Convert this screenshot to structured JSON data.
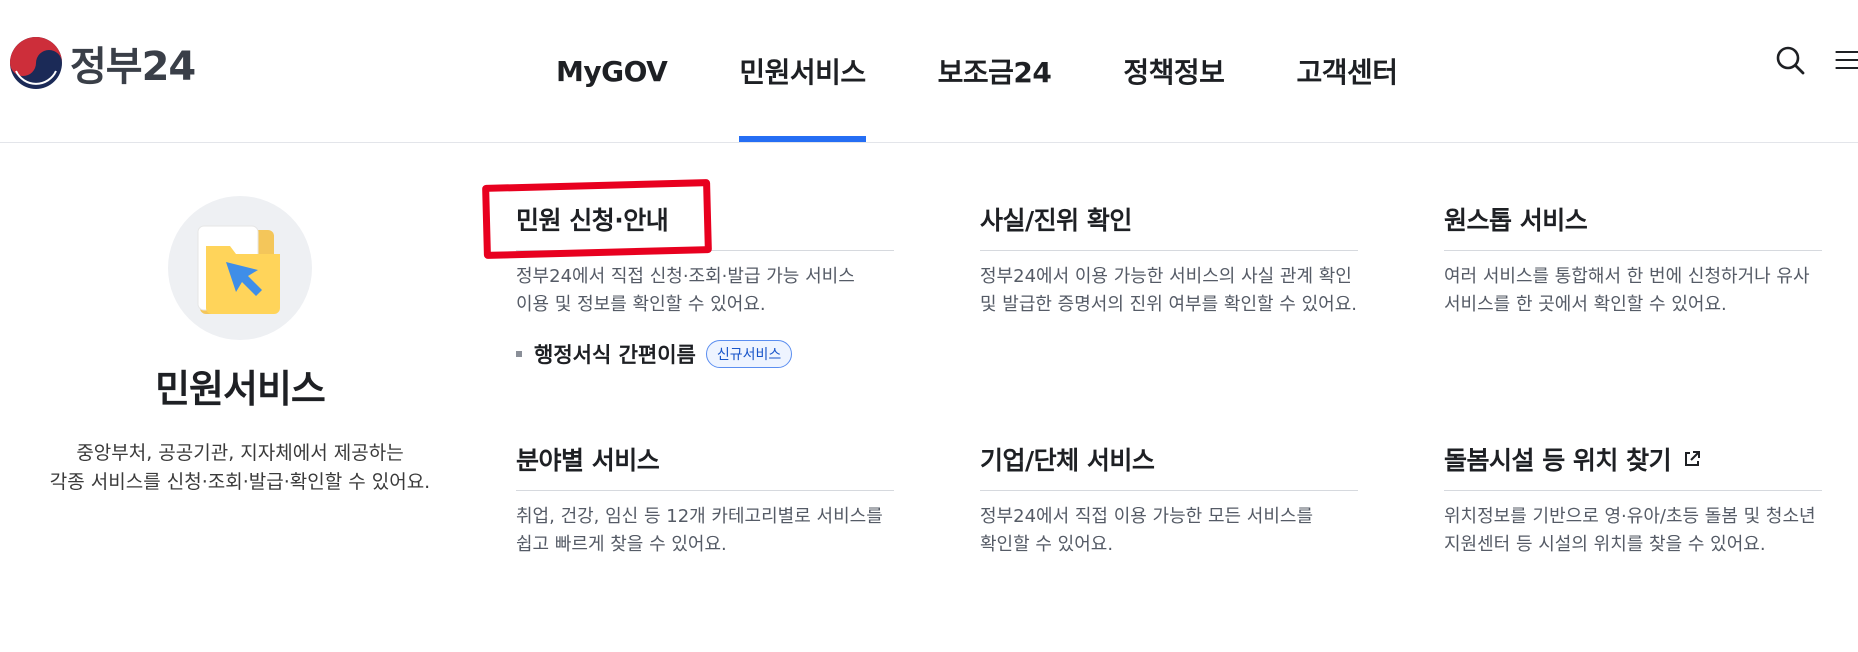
{
  "header": {
    "logo_text": "정부24",
    "nav": [
      {
        "label": "MyGOV",
        "active": false
      },
      {
        "label": "민원서비스",
        "active": true
      },
      {
        "label": "보조금24",
        "active": false
      },
      {
        "label": "정책정보",
        "active": false
      },
      {
        "label": "고객센터",
        "active": false
      }
    ],
    "utility_icons": [
      "search-icon",
      "menu-icon"
    ],
    "accent_color": "#256ef4"
  },
  "promo": {
    "icon": "folder-cursor-icon",
    "title": "민원서비스",
    "desc_line1": "중앙부처, 공공기관, 지자체에서 제공하는",
    "desc_line2": "각종 서비스를 신청·조회·발급·확인할 수 있어요."
  },
  "cards": [
    {
      "title": "민원 신청·안내",
      "desc_line1": "정부24에서 직접 신청·조회·발급 가능 서비스",
      "desc_line2": "이용 및 정보를 확인할 수 있어요.",
      "sub_link": "행정서식 간편이름",
      "badge": "신규서비스",
      "highlighted": true
    },
    {
      "title": "사실/진위 확인",
      "desc_line1": "정부24에서 이용 가능한 서비스의 사실 관계 확인",
      "desc_line2": "및 발급한 증명서의 진위 여부를 확인할 수 있어요."
    },
    {
      "title": "원스톱 서비스",
      "desc_line1": "여러 서비스를 통합해서 한 번에 신청하거나 유사",
      "desc_line2": "서비스를 한 곳에서 확인할 수 있어요."
    },
    {
      "title": "분야별 서비스",
      "desc_line1": "취업, 건강, 임신 등 12개 카테고리별로 서비스를",
      "desc_line2": "쉽고 빠르게 찾을 수 있어요."
    },
    {
      "title": "기업/단체 서비스",
      "desc_line1": "정부24에서 직접 이용 가능한 모든 서비스를",
      "desc_line2": "확인할 수 있어요."
    },
    {
      "title": "돌봄시설 등 위치 찾기",
      "external_icon": "external-link-icon",
      "desc_line1": "위치정보를 기반으로 영·유아/초등 돌봄 및 청소년",
      "desc_line2": "지원센터 등 시설의 위치를 찾을 수 있어요."
    }
  ],
  "highlight_color": "#e8001f"
}
